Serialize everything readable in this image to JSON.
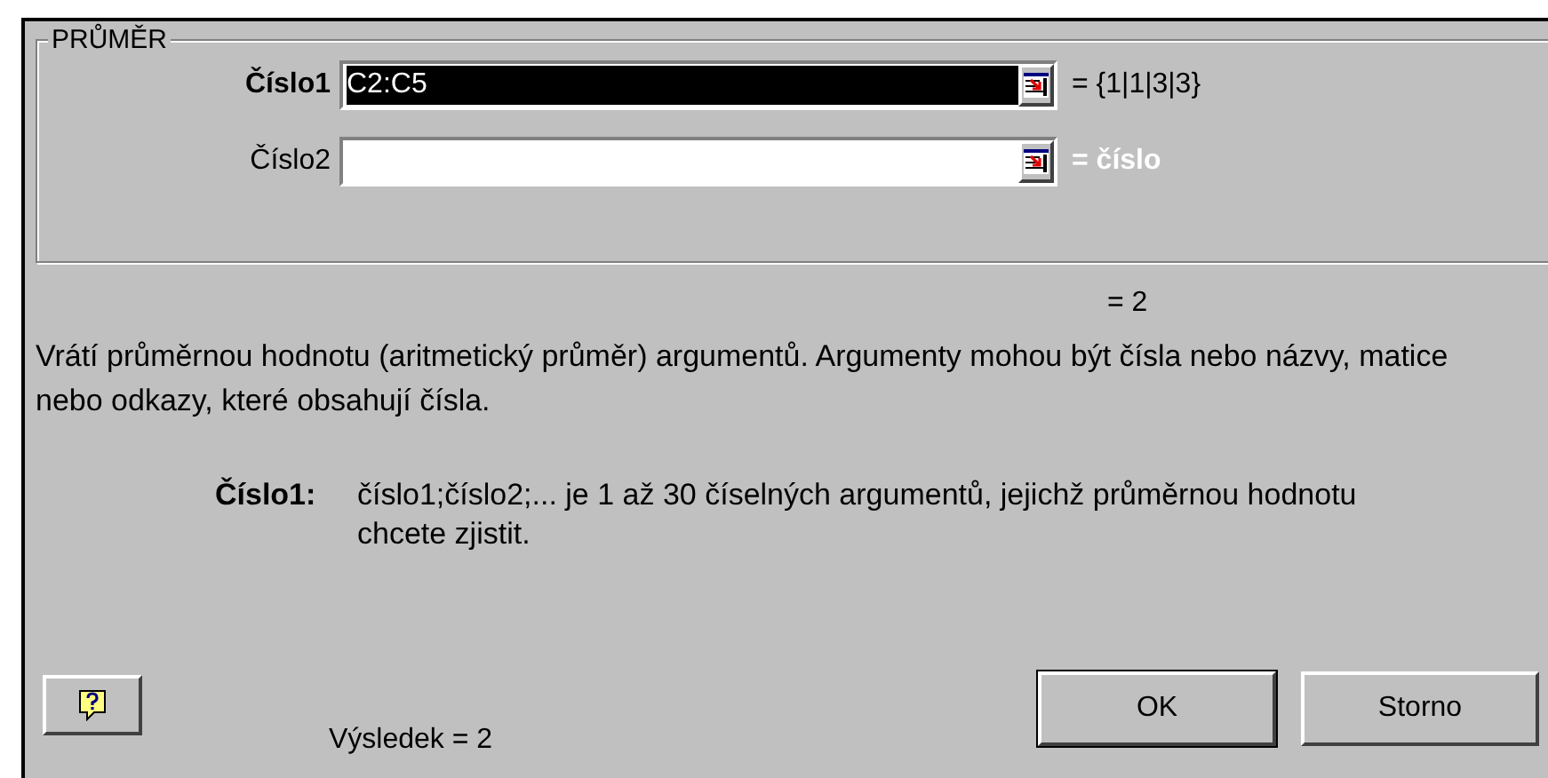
{
  "group": {
    "title": "PRŮMĚR"
  },
  "arguments": [
    {
      "label": "Číslo1",
      "value": "C2:C5",
      "selected": true,
      "result": "= {1|1|3|3}",
      "kind": "value"
    },
    {
      "label": "Číslo2",
      "selected": false,
      "result": "= číslo",
      "kind": "hint"
    }
  ],
  "formula_result": "= 2",
  "description": "Vrátí průměrnou hodnotu (aritmetický průměr) argumentů. Argumenty mohou být čísla nebo názvy, matice nebo odkazy, které obsahují čísla.",
  "argument_help": {
    "label": "Číslo1:",
    "text": "číslo1;číslo2;... je 1 až 30 číselných argumentů, jejichž průměrnou hodnotu chcete zjistit."
  },
  "result_line": "Výsledek = 2",
  "buttons": [
    "OK",
    "Storno"
  ]
}
